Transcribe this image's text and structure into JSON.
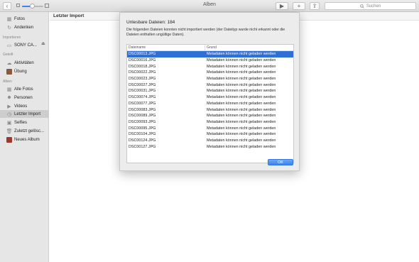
{
  "window": {
    "title": "Alben"
  },
  "toolbar": {
    "back_icon": "chevron-left-icon",
    "play_label": "▶",
    "add_label": "+",
    "share_label": "⇪",
    "search_placeholder": "Suchen",
    "zoom_level": 0.45
  },
  "sidebar": {
    "items_top": [
      {
        "label": "Fotos",
        "icon": "photos-icon"
      },
      {
        "label": "Andenken",
        "icon": "memories-icon"
      }
    ],
    "section_import": "Importieren",
    "device": {
      "label": "SONY CA...",
      "icon": "camera-icon"
    },
    "section_shared": "Geteilt",
    "shared_items": [
      {
        "label": "Aktivitäten",
        "icon": "cloud-icon"
      },
      {
        "label": "Übung",
        "icon": "album-thumb-icon"
      }
    ],
    "section_albums": "Alben",
    "album_items": [
      {
        "label": "Alle Fotos",
        "icon": "photos-icon"
      },
      {
        "label": "Personen",
        "icon": "person-icon"
      },
      {
        "label": "Videos",
        "icon": "video-icon"
      },
      {
        "label": "Letzter Import",
        "icon": "clock-icon"
      },
      {
        "label": "Selfies",
        "icon": "selfie-icon"
      },
      {
        "label": "Zuletzt gelösc...",
        "icon": "trash-icon"
      },
      {
        "label": "Neues Album",
        "icon": "album-thumb-icon"
      }
    ]
  },
  "main": {
    "title": "Letzter Import"
  },
  "dialog": {
    "title": "Unlesbare Dateien: 184",
    "message": "Die folgenden Dateien konnten nicht importiert werden (der Dateityp wurde nicht erkannt oder die Dateien enthalten ungültige Daten).",
    "col_name": "Dateiname",
    "col_reason": "Grund",
    "rows": [
      {
        "name": "DSC00013.JPG",
        "reason": "Metadaten können nicht geladen werden"
      },
      {
        "name": "DSC00016.JPG",
        "reason": "Metadaten können nicht geladen werden"
      },
      {
        "name": "DSC00018.JPG",
        "reason": "Metadaten können nicht geladen werden"
      },
      {
        "name": "DSC00022.JPG",
        "reason": "Metadaten können nicht geladen werden"
      },
      {
        "name": "DSC00023.JPG",
        "reason": "Metadaten können nicht geladen werden"
      },
      {
        "name": "DSC00027.JPG",
        "reason": "Metadaten können nicht geladen werden"
      },
      {
        "name": "DSC00031.JPG",
        "reason": "Metadaten können nicht geladen werden"
      },
      {
        "name": "DSC00074.JPG",
        "reason": "Metadaten können nicht geladen werden"
      },
      {
        "name": "DSC00077.JPG",
        "reason": "Metadaten können nicht geladen werden"
      },
      {
        "name": "DSC00083.JPG",
        "reason": "Metadaten können nicht geladen werden"
      },
      {
        "name": "DSC00089.JPG",
        "reason": "Metadaten können nicht geladen werden"
      },
      {
        "name": "DSC00093.JPG",
        "reason": "Metadaten können nicht geladen werden"
      },
      {
        "name": "DSC00095.JPG",
        "reason": "Metadaten können nicht geladen werden"
      },
      {
        "name": "DSC00104.JPG",
        "reason": "Metadaten können nicht geladen werden"
      },
      {
        "name": "DSC00124.JPG",
        "reason": "Metadaten können nicht geladen werden"
      },
      {
        "name": "DSC00127.JPG",
        "reason": "Metadaten können nicht geladen werden"
      }
    ],
    "ok_label": "OK"
  },
  "colors": {
    "accent": "#2f6fd6",
    "sidebar_bg": "#e6e6e6",
    "dialog_bg": "#ececec"
  }
}
